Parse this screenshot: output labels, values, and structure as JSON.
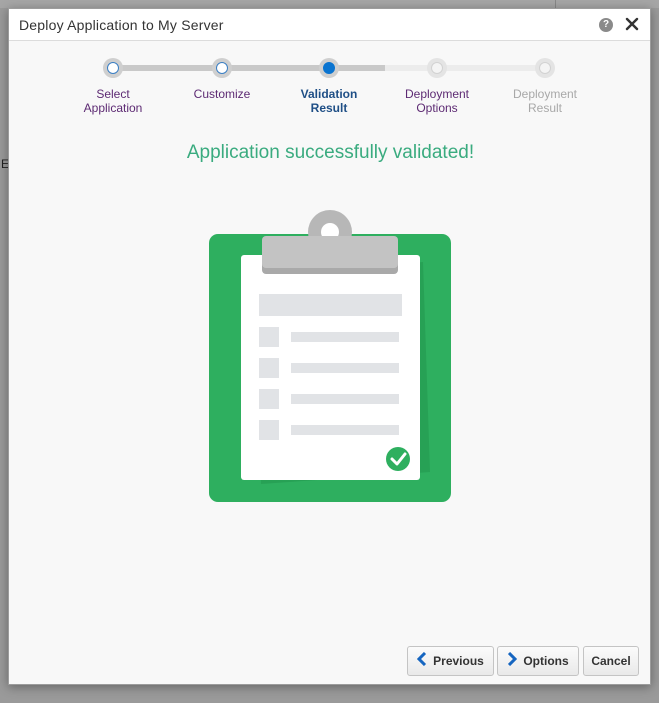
{
  "dialog": {
    "title": "Deploy Application to My Server",
    "help_glyph": "?",
    "close_glyph": "✕"
  },
  "train": {
    "steps": [
      {
        "label_line1": "Select",
        "label_line2": "Application",
        "state": "visited"
      },
      {
        "label_line1": "Customize",
        "label_line2": "",
        "state": "visited"
      },
      {
        "label_line1": "Validation",
        "label_line2": "Result",
        "state": "current"
      },
      {
        "label_line1": "Deployment",
        "label_line2": "Options",
        "state": "next"
      },
      {
        "label_line1": "Deployment",
        "label_line2": "Result",
        "state": "disabled"
      }
    ]
  },
  "message": "Application successfully validated!",
  "illustration": {
    "name": "clipboard-checklist",
    "colors": {
      "board": "#2eaf5f",
      "clip": "#bdbdbd",
      "paper": "#ffffff",
      "lines": "#e1e3e6",
      "check": "#2eaf5f"
    }
  },
  "footer": {
    "previous_label": "Previous",
    "options_label": "Options",
    "cancel_label": "Cancel",
    "previous_icon": "‹",
    "options_icon": "›"
  },
  "colors": {
    "success_text": "#3aab7f",
    "visited_label": "#5d2a73",
    "current_label": "#1f4f86",
    "current_stop": "#0a74d0"
  }
}
